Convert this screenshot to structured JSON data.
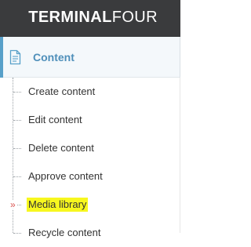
{
  "brand": {
    "logo_bold": "TERMINAL",
    "logo_light": "FOUR"
  },
  "section": {
    "title": "Content",
    "icon": "document-icon",
    "accent_color": "#58a0c9"
  },
  "menu": {
    "items": [
      {
        "label": "Create content"
      },
      {
        "label": "Edit content"
      },
      {
        "label": "Delete content"
      },
      {
        "label": "Approve content"
      },
      {
        "label": "Media library",
        "active": true,
        "highlight_color": "#f7f71f"
      },
      {
        "label": "Recycle content"
      }
    ],
    "active_marker": "»"
  }
}
